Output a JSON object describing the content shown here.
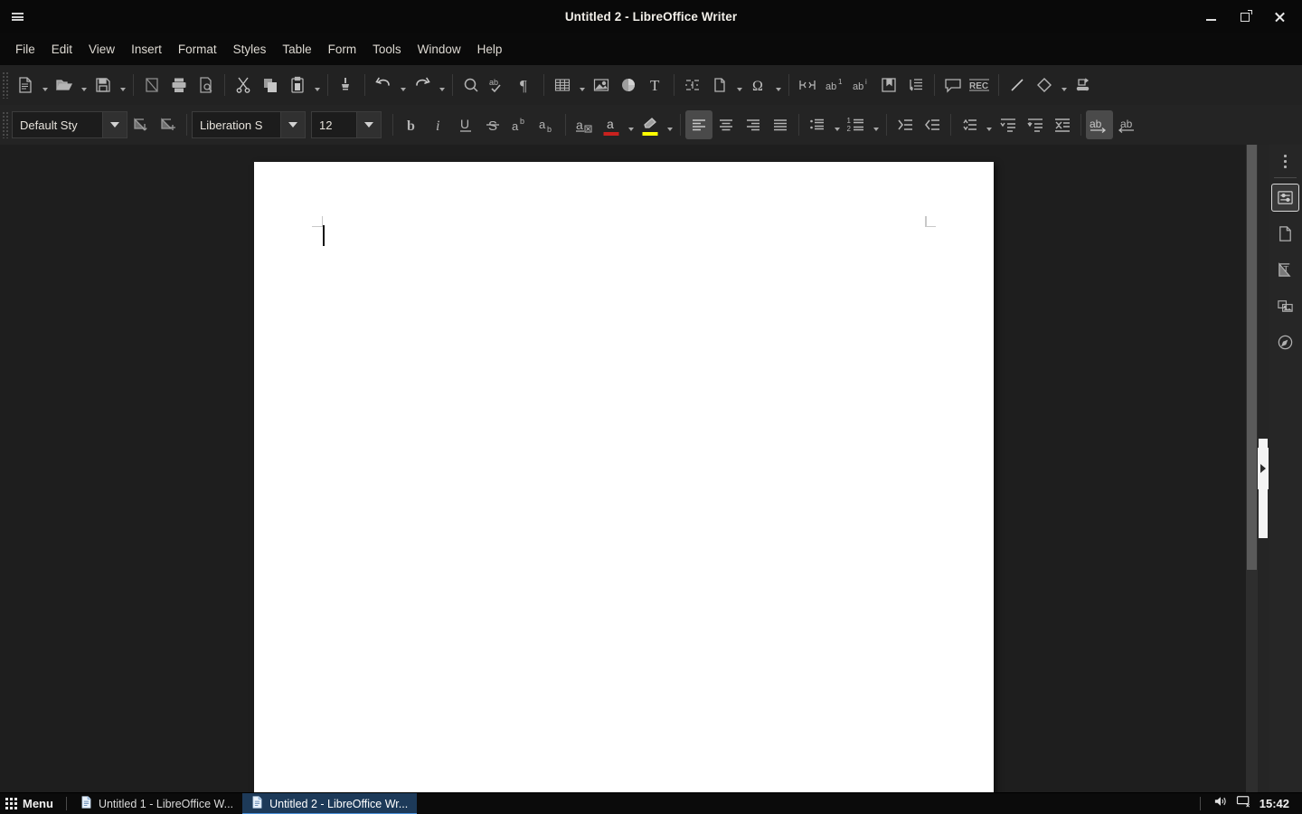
{
  "window": {
    "title": "Untitled 2 - LibreOffice Writer",
    "hamburger_name": "global-menu-icon",
    "minimize_label": "Minimize",
    "maximize_label": "Restore",
    "close_label": "Close"
  },
  "menubar": {
    "items": [
      {
        "label": "File"
      },
      {
        "label": "Edit"
      },
      {
        "label": "View"
      },
      {
        "label": "Insert"
      },
      {
        "label": "Format"
      },
      {
        "label": "Styles"
      },
      {
        "label": "Table"
      },
      {
        "label": "Form"
      },
      {
        "label": "Tools"
      },
      {
        "label": "Window"
      },
      {
        "label": "Help"
      }
    ]
  },
  "toolbar_standard": {
    "items": [
      {
        "name": "new-document-icon",
        "label": "New",
        "dropdown": true
      },
      {
        "name": "open-document-icon",
        "label": "Open",
        "dropdown": true
      },
      {
        "name": "save-icon",
        "label": "Save",
        "dropdown": true
      },
      {
        "name": "export-pdf-icon",
        "label": "Export as PDF"
      },
      {
        "name": "print-icon",
        "label": "Print"
      },
      {
        "name": "print-preview-icon",
        "label": "Toggle Print Preview"
      },
      {
        "name": "cut-icon",
        "label": "Cut"
      },
      {
        "name": "copy-icon",
        "label": "Copy"
      },
      {
        "name": "paste-icon",
        "label": "Paste",
        "dropdown": true
      },
      {
        "name": "clone-formatting-icon",
        "label": "Clone Formatting"
      },
      {
        "name": "undo-icon",
        "label": "Undo",
        "dropdown": true
      },
      {
        "name": "redo-icon",
        "label": "Redo",
        "dropdown": true
      },
      {
        "name": "find-replace-icon",
        "label": "Find and Replace"
      },
      {
        "name": "spelling-icon",
        "label": "Check Spelling"
      },
      {
        "name": "formatting-marks-icon",
        "label": "Formatting Marks"
      },
      {
        "name": "insert-table-icon",
        "label": "Insert Table",
        "dropdown": true
      },
      {
        "name": "insert-image-icon",
        "label": "Insert Image"
      },
      {
        "name": "insert-chart-icon",
        "label": "Insert Chart"
      },
      {
        "name": "insert-textbox-icon",
        "label": "Insert Text Box"
      },
      {
        "name": "insert-page-break-icon",
        "label": "Insert Page Break"
      },
      {
        "name": "insert-field-icon",
        "label": "Insert Field",
        "dropdown": true
      },
      {
        "name": "insert-special-character-icon",
        "label": "Insert Special Character",
        "dropdown": true
      },
      {
        "name": "insert-section-icon",
        "label": "Insert Section"
      },
      {
        "name": "insert-footnote-icon",
        "label": "Insert Footnote"
      },
      {
        "name": "insert-endnote-icon",
        "label": "Insert Endnote"
      },
      {
        "name": "insert-bookmark-icon",
        "label": "Insert Bookmark"
      },
      {
        "name": "insert-cross-reference-icon",
        "label": "Insert Cross-reference"
      },
      {
        "name": "insert-comment-icon",
        "label": "Insert Comment"
      },
      {
        "name": "track-changes-icon",
        "label": "Track Changes"
      },
      {
        "name": "insert-line-icon",
        "label": "Insert Line"
      },
      {
        "name": "basic-shapes-icon",
        "label": "Basic Shapes",
        "dropdown": true
      },
      {
        "name": "show-draw-functions-icon",
        "label": "Show Draw Functions"
      }
    ]
  },
  "toolbar_formatting": {
    "paragraph_style": {
      "name": "paragraph-style-combo",
      "value": "Default Sty",
      "placeholder": "Paragraph Style"
    },
    "update_style_label": "Update Selected Style",
    "new_style_label": "New Style from Selection",
    "font_name": {
      "name": "font-name-combo",
      "value": "Liberation S",
      "placeholder": "Font Name"
    },
    "font_size": {
      "name": "font-size-combo",
      "value": "12",
      "placeholder": "Font Size"
    },
    "items": [
      {
        "name": "bold-button",
        "label": "Bold",
        "active": false
      },
      {
        "name": "italic-button",
        "label": "Italic",
        "active": false
      },
      {
        "name": "underline-button",
        "label": "Underline",
        "active": false
      },
      {
        "name": "strikethrough-button",
        "label": "Strikethrough",
        "active": false
      },
      {
        "name": "superscript-button",
        "label": "Superscript",
        "active": false
      },
      {
        "name": "subscript-button",
        "label": "Subscript",
        "active": false
      },
      {
        "name": "clear-formatting-button",
        "label": "Clear Direct Formatting",
        "active": false
      },
      {
        "name": "font-color-button",
        "label": "Font Color",
        "dropdown": true,
        "swatch": "#c9211e"
      },
      {
        "name": "highlight-color-button",
        "label": "Character Highlighting Color",
        "dropdown": true,
        "swatch": "#ffff00"
      },
      {
        "name": "align-left-button",
        "label": "Align Left",
        "active": true
      },
      {
        "name": "align-center-button",
        "label": "Align Center",
        "active": false
      },
      {
        "name": "align-right-button",
        "label": "Align Right",
        "active": false
      },
      {
        "name": "align-justified-button",
        "label": "Justified",
        "active": false
      },
      {
        "name": "unordered-list-button",
        "label": "Unordered List",
        "dropdown": true
      },
      {
        "name": "ordered-list-button",
        "label": "Ordered List",
        "dropdown": true
      },
      {
        "name": "increase-indent-button",
        "label": "Increase Indent",
        "active": false
      },
      {
        "name": "decrease-indent-button",
        "label": "Decrease Indent",
        "active": false
      },
      {
        "name": "line-spacing-button",
        "label": "Set Line Spacing",
        "dropdown": true
      },
      {
        "name": "paragraph-spacing-above-button",
        "label": "Increase Paragraph Spacing"
      },
      {
        "name": "paragraph-spacing-below-button",
        "label": "Decrease Paragraph Spacing"
      },
      {
        "name": "toggle-formatting-marks-button",
        "label": "Toggle Formatting Marks"
      },
      {
        "name": "left-to-right-button",
        "label": "Left-To-Right",
        "active": true
      },
      {
        "name": "right-to-left-button",
        "label": "Right-To-Left",
        "active": false
      }
    ]
  },
  "sidebar": {
    "more_options_label": "Sidebar Settings",
    "items": [
      {
        "name": "sidebar-item-properties",
        "label": "Properties",
        "selected": true
      },
      {
        "name": "sidebar-item-page",
        "label": "Page",
        "selected": false
      },
      {
        "name": "sidebar-item-style-inspector",
        "label": "Style Inspector",
        "selected": false
      },
      {
        "name": "sidebar-item-gallery",
        "label": "Gallery",
        "selected": false
      },
      {
        "name": "sidebar-item-navigator",
        "label": "Navigator",
        "selected": false
      }
    ]
  },
  "document": {
    "page_label": "Page 1",
    "content": "",
    "hide_sidebar_label": "Hide Sidebar"
  },
  "taskbar": {
    "menu_label": "Menu",
    "windows": [
      {
        "name": "taskbar-window-untitled-1",
        "label": "Untitled 1 - LibreOffice W...",
        "active": false
      },
      {
        "name": "taskbar-window-untitled-2",
        "label": "Untitled 2 - LibreOffice Wr...",
        "active": true
      }
    ],
    "tray": [
      {
        "name": "volume-icon",
        "label": "Volume"
      },
      {
        "name": "display-off-icon",
        "label": "Display"
      }
    ],
    "clock": "15:42"
  },
  "colors": {
    "titlebar_bg": "#090909",
    "toolbar_bg": "#222222",
    "doc_area_bg": "#1e1e1e",
    "page_bg": "#ffffff",
    "accent": "#4a90d9",
    "font_color_swatch": "#c9211e",
    "highlight_swatch": "#ffff00"
  }
}
